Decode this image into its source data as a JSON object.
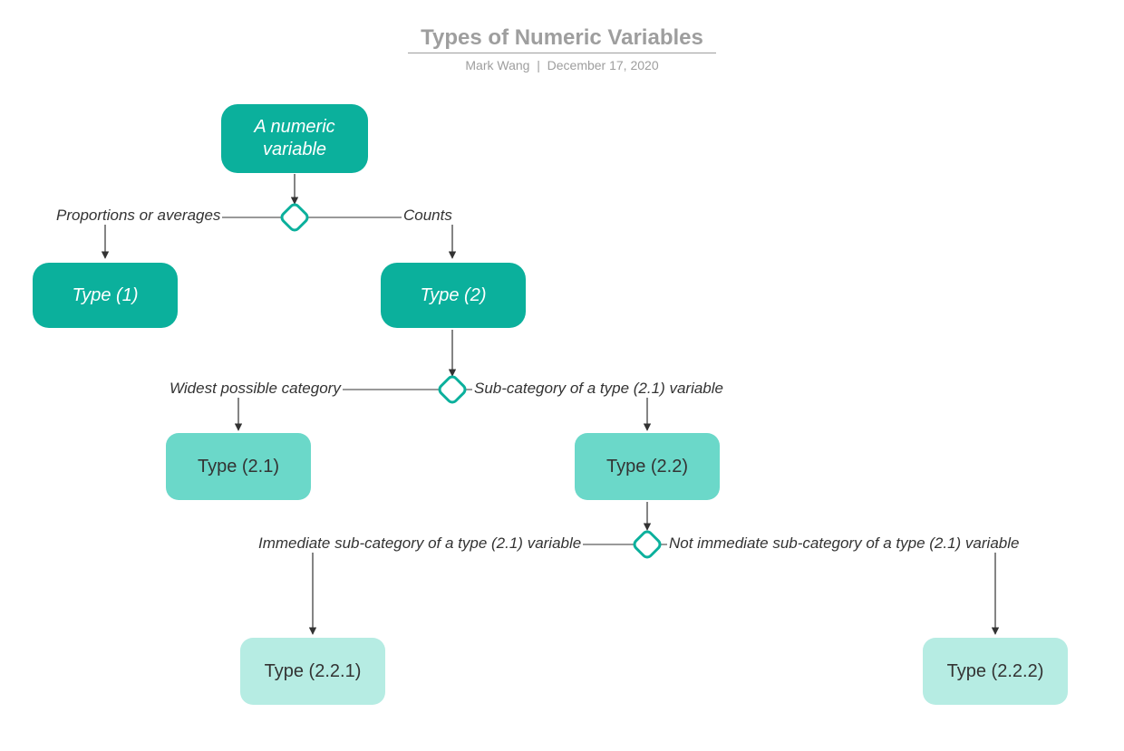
{
  "header": {
    "title": "Types of Numeric Variables",
    "author": "Mark Wang",
    "date": "December 17, 2020"
  },
  "nodes": {
    "root": "A numeric variable",
    "type1": "Type (1)",
    "type2": "Type (2)",
    "type21": "Type (2.1)",
    "type22": "Type (2.2)",
    "type221": "Type (2.2.1)",
    "type222": "Type (2.2.2)"
  },
  "edges": {
    "proportions": "Proportions or averages",
    "counts": "Counts",
    "widest": "Widest possible category",
    "subcat": "Sub-category of a type (2.1) variable",
    "immediate": "Immediate sub-category of a type (2.1) variable",
    "not_immediate": "Not immediate sub-category of a type (2.1) variable"
  },
  "colors": {
    "dark": "#0bb09c",
    "mid": "#6bd8c9",
    "light": "#b6ece3",
    "grey": "#9e9e9e"
  }
}
